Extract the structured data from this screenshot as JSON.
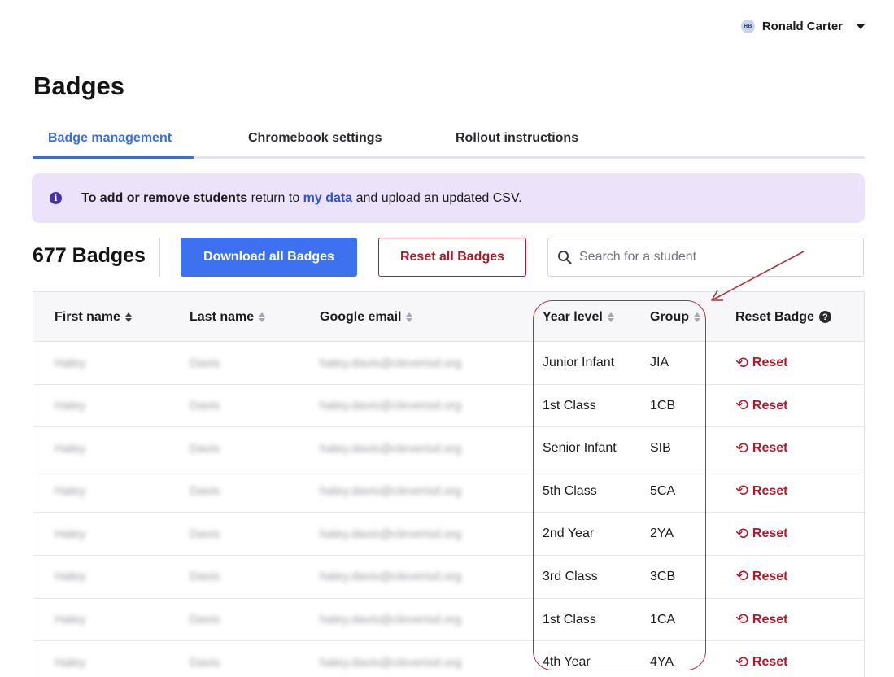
{
  "user": {
    "initials": "RB",
    "name": "Ronald Carter"
  },
  "page_title": "Badges",
  "tabs": [
    {
      "label": "Badge management"
    },
    {
      "label": "Chromebook settings"
    },
    {
      "label": "Rollout instructions"
    }
  ],
  "banner": {
    "bold": "To add or remove students",
    "middle": " return to ",
    "link": "my data",
    "end": " and upload an updated CSV."
  },
  "toolbar": {
    "count": "677 Badges",
    "download_label": "Download all Badges",
    "reset_all_label": "Reset all Badges",
    "search_placeholder": "Search for a student"
  },
  "table": {
    "headers": {
      "first_name": "First name",
      "last_name": "Last name",
      "email": "Google email",
      "year_level": "Year level",
      "group": "Group",
      "reset": "Reset Badge"
    },
    "reset_label": "Reset",
    "rows": [
      {
        "first": "Haley",
        "last": "Davis",
        "email": "haley.davis@cleverisd.org",
        "year": "Junior Infant",
        "group": "JIA"
      },
      {
        "first": "Haley",
        "last": "Davis",
        "email": "haley.davis@cleverisd.org",
        "year": "1st Class",
        "group": "1CB"
      },
      {
        "first": "Haley",
        "last": "Davis",
        "email": "haley.davis@cleverisd.org",
        "year": "Senior Infant",
        "group": "SIB"
      },
      {
        "first": "Haley",
        "last": "Davis",
        "email": "haley.davis@cleverisd.org",
        "year": "5th Class",
        "group": "5CA"
      },
      {
        "first": "Haley",
        "last": "Davis",
        "email": "haley.davis@cleverisd.org",
        "year": "2nd Year",
        "group": "2YA"
      },
      {
        "first": "Haley",
        "last": "Davis",
        "email": "haley.davis@cleverisd.org",
        "year": "3rd Class",
        "group": "3CB"
      },
      {
        "first": "Haley",
        "last": "Davis",
        "email": "haley.davis@cleverisd.org",
        "year": "1st Class",
        "group": "1CA"
      },
      {
        "first": "Haley",
        "last": "Davis",
        "email": "haley.davis@cleverisd.org",
        "year": "4th Year",
        "group": "4YA"
      }
    ]
  },
  "colors": {
    "accent": "#3e71ef",
    "danger": "#b3182a",
    "banner_bg": "#ece3fa",
    "annotation": "#b0323d"
  }
}
